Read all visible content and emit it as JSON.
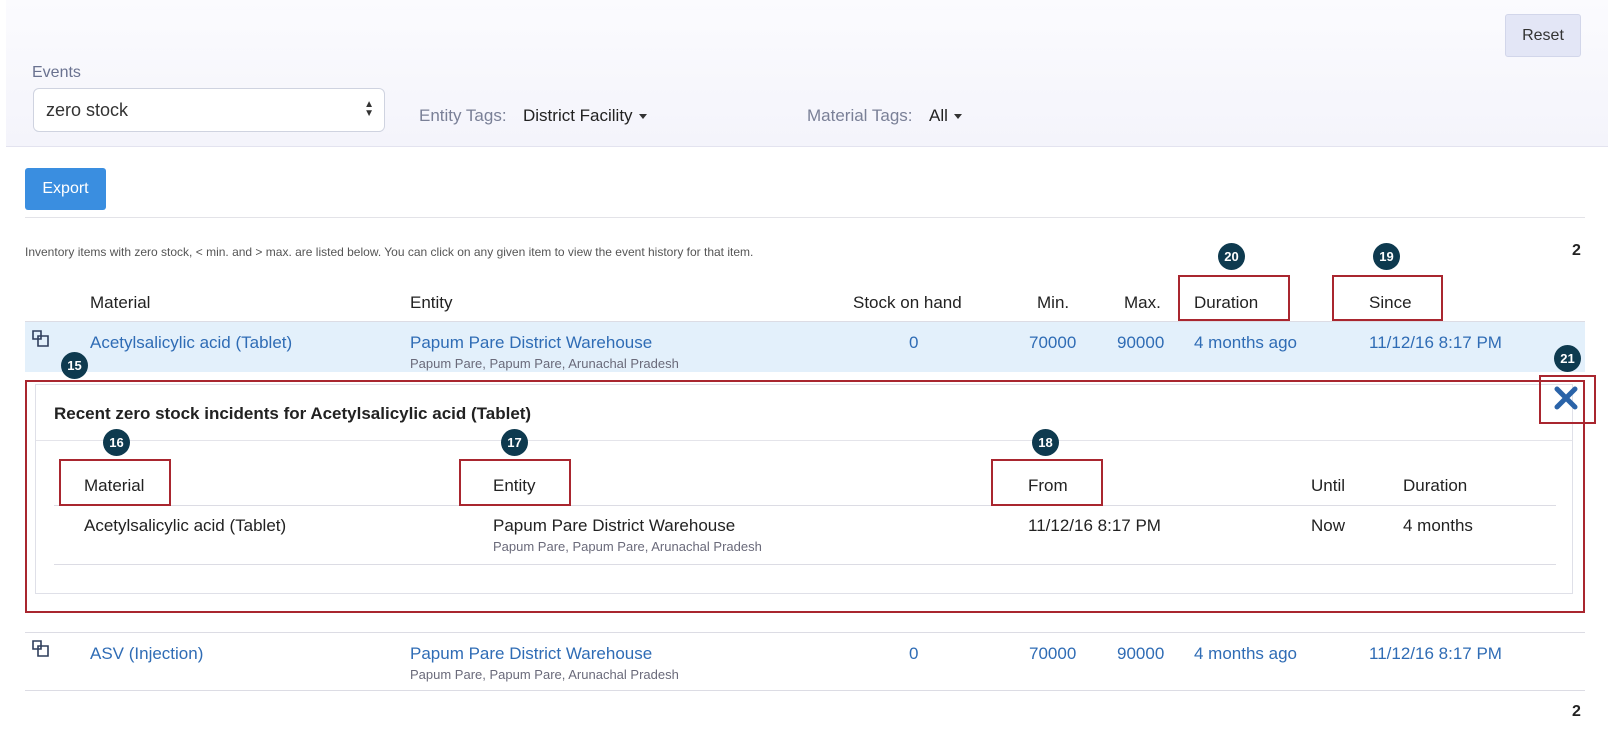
{
  "filters": {
    "reset_label": "Reset",
    "events_label": "Events",
    "events_value": "zero stock",
    "entity_tags_label": "Entity Tags:",
    "entity_tags_value": "District Facility",
    "material_tags_label": "Material Tags:",
    "material_tags_value": "All"
  },
  "toolbar": {
    "export_label": "Export",
    "info_text": "Inventory items with zero stock, < min. and > max. are listed below. You can click on any given item to view the event history for that item.",
    "count_top": "2",
    "count_bottom": "2"
  },
  "table": {
    "headers": {
      "material": "Material",
      "entity": "Entity",
      "stock": "Stock on hand",
      "min": "Min.",
      "max": "Max.",
      "duration": "Duration",
      "since": "Since"
    },
    "rows": [
      {
        "material": "Acetylsalicylic acid (Tablet)",
        "entity": "Papum Pare District Warehouse",
        "location": "Papum Pare, Papum Pare, Arunachal Pradesh",
        "stock": "0",
        "min": "70000",
        "max": "90000",
        "duration": "4 months ago",
        "since": "11/12/16 8:17 PM"
      },
      {
        "material": "ASV (Injection)",
        "entity": "Papum Pare District Warehouse",
        "location": "Papum Pare, Papum Pare, Arunachal Pradesh",
        "stock": "0",
        "min": "70000",
        "max": "90000",
        "duration": "4 months ago",
        "since": "11/12/16 8:17 PM"
      }
    ]
  },
  "history": {
    "title": "Recent  zero stock  incidents for Acetylsalicylic acid (Tablet)",
    "headers": {
      "material": "Material",
      "entity": "Entity",
      "from": "From",
      "until": "Until",
      "duration": "Duration"
    },
    "row": {
      "material": "Acetylsalicylic acid (Tablet)",
      "entity": "Papum Pare District Warehouse",
      "location": "Papum Pare, Papum Pare, Arunachal Pradesh",
      "from": "11/12/16 8:17 PM",
      "until": "Now",
      "duration": "4 months"
    }
  },
  "markers": {
    "m15": "15",
    "m16": "16",
    "m17": "17",
    "m18": "18",
    "m19": "19",
    "m20": "20",
    "m21": "21"
  },
  "colors": {
    "accent": "#3a8ee0",
    "link": "#2f6cb5",
    "annotation": "#a9262f",
    "marker": "#0e3a4f",
    "selected_row": "#e3f0fb"
  },
  "icons": {
    "row_expand": "copy-icon",
    "close": "close-icon"
  }
}
